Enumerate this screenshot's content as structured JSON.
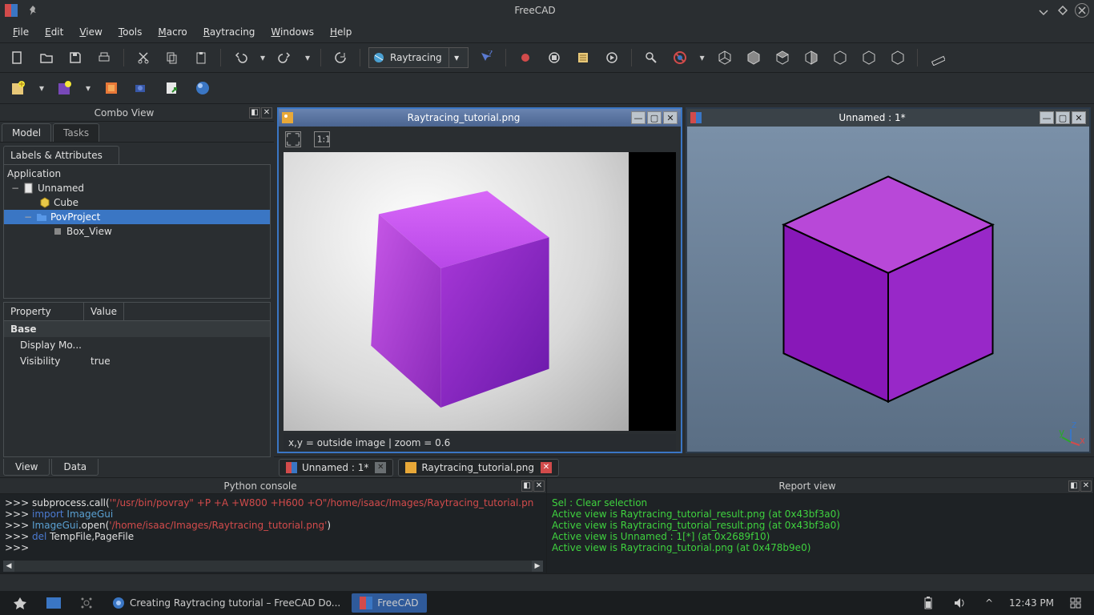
{
  "window": {
    "title": "FreeCAD"
  },
  "menu": [
    "File",
    "Edit",
    "View",
    "Tools",
    "Macro",
    "Raytracing",
    "Windows",
    "Help"
  ],
  "menu_accel": [
    "F",
    "E",
    "V",
    "T",
    "M",
    "R",
    "W",
    "H"
  ],
  "workbench": {
    "label": "Raytracing"
  },
  "combo": {
    "title": "Combo View",
    "tabs": [
      "Model",
      "Tasks"
    ],
    "la_header": "Labels & Attributes",
    "tree": {
      "root": "Application",
      "doc": "Unnamed",
      "items": [
        "Cube",
        "PovProject",
        "Box_View"
      ]
    },
    "prop_headers": [
      "Property",
      "Value"
    ],
    "props": [
      {
        "name": "Base",
        "value": "",
        "base": true
      },
      {
        "name": "Display Mo...",
        "value": ""
      },
      {
        "name": "Visibility",
        "value": "true"
      }
    ],
    "bottom_tabs": [
      "View",
      "Data"
    ]
  },
  "mdi": {
    "left": {
      "title": "Raytracing_tutorial.png",
      "status": "x,y = outside image  |  zoom = 0.6"
    },
    "right": {
      "title": "Unnamed : 1*"
    }
  },
  "doc_tabs": [
    {
      "label": "Unnamed : 1*",
      "closable": true
    },
    {
      "label": "Raytracing_tutorial.png",
      "closable": true
    }
  ],
  "python": {
    "title": "Python console",
    "lines": [
      {
        "pre": ">>> ",
        "t": [
          {
            "c": "",
            "s": "subprocess.call("
          },
          {
            "c": "hl-s",
            "s": "'\"/usr/bin/povray\" +P +A +W800 +H600 +O\"/home/isaac/Images/Raytracing_tutorial.pn"
          }
        ]
      },
      {
        "pre": ">>> ",
        "t": [
          {
            "c": "hl-k",
            "s": "import "
          },
          {
            "c": "hl-i",
            "s": "ImageGui"
          }
        ]
      },
      {
        "pre": ">>> ",
        "t": [
          {
            "c": "hl-i",
            "s": "ImageGui"
          },
          {
            "c": "",
            "s": ".open("
          },
          {
            "c": "hl-s",
            "s": "'/home/isaac/Images/Raytracing_tutorial.png'"
          },
          {
            "c": "",
            "s": ")"
          }
        ]
      },
      {
        "pre": ">>> ",
        "t": [
          {
            "c": "hl-k",
            "s": "del "
          },
          {
            "c": "",
            "s": "TempFile,PageFile"
          }
        ]
      },
      {
        "pre": ">>> ",
        "t": []
      }
    ]
  },
  "report": {
    "title": "Report view",
    "lines": [
      "Sel : Clear selection",
      "Active view is Raytracing_tutorial_result.png (at 0x43bf3a0)",
      "Active view is Raytracing_tutorial_result.png (at 0x43bf3a0)",
      "Active view is Unnamed : 1[*] (at 0x2689f10)",
      "Active view is Raytracing_tutorial.png (at 0x478b9e0)"
    ]
  },
  "taskbar": {
    "items": [
      {
        "label": "Creating Raytracing tutorial – FreeCAD Do..."
      },
      {
        "label": "FreeCAD",
        "active": true
      }
    ],
    "clock": "12:43 PM"
  }
}
